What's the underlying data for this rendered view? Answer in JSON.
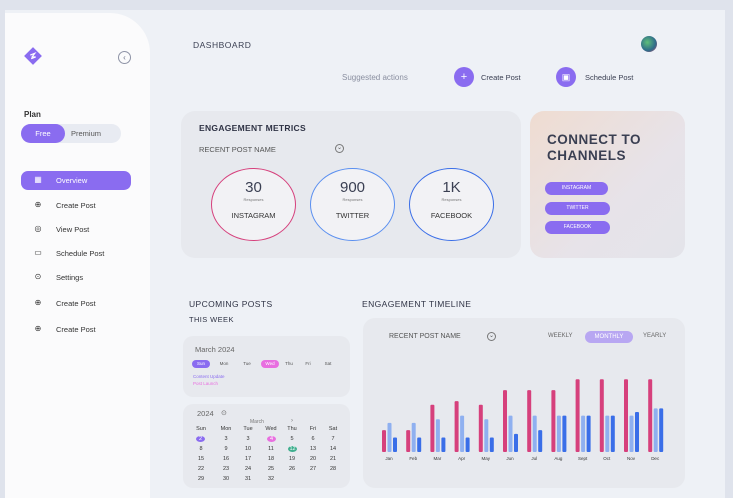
{
  "sidebar": {
    "plan_label": "Plan",
    "plan_free": "Free",
    "plan_premium": "Premium",
    "items": [
      {
        "label": "Overview",
        "icon": "grid-icon",
        "active": true
      },
      {
        "label": "Create Post",
        "icon": "plus-circle-icon"
      },
      {
        "label": "View Post",
        "icon": "eye-icon"
      },
      {
        "label": "Schedule Post",
        "icon": "calendar-icon"
      },
      {
        "label": "Settings",
        "icon": "gear-icon"
      },
      {
        "label": "Create Post",
        "icon": "plus-circle-icon"
      },
      {
        "label": "Create Post",
        "icon": "plus-circle-icon"
      }
    ]
  },
  "header": {
    "title": "DASHBOARD",
    "suggested": "Suggested actions",
    "create_post": "Create Post",
    "schedule_post": "Schedule Post"
  },
  "metrics": {
    "title": "ENGAGEMENT METRICS",
    "subtitle": "RECENT POST NAME",
    "items": [
      {
        "value": "30",
        "resp": "Responses",
        "name": "INSTAGRAM",
        "color": "#d6407c"
      },
      {
        "value": "900",
        "resp": "Responses",
        "name": "TWITTER",
        "color": "#5a8ff0"
      },
      {
        "value": "1K",
        "resp": "Responses",
        "name": "FACEBOOK",
        "color": "#3a6ee8"
      }
    ]
  },
  "connect": {
    "title": "CONNECT TO CHANNELS",
    "buttons": [
      "INSTAGRAM",
      "TWITTER",
      "FACEBOOK"
    ]
  },
  "upcoming": {
    "title": "UPCOMING POSTS",
    "this_week": "THIS WEEK",
    "month": "March 2024",
    "days": [
      "Sun",
      "Mon",
      "Tue",
      "Wed",
      "Thu",
      "Fri",
      "Sat"
    ],
    "event1": "Content Update",
    "event2": "Post Launch",
    "year": "2024",
    "month_small": "March",
    "calendar": [
      [
        "Sun",
        "Mon",
        "Tue",
        "Wed",
        "Thu",
        "Fri",
        "Sat"
      ],
      [
        "2",
        "3",
        "3",
        "4",
        "5",
        "6",
        "7"
      ],
      [
        "8",
        "9",
        "10",
        "11",
        "12",
        "13",
        "14"
      ],
      [
        "15",
        "16",
        "17",
        "18",
        "19",
        "20",
        "21"
      ],
      [
        "22",
        "23",
        "24",
        "25",
        "26",
        "27",
        "28"
      ],
      [
        "29",
        "30",
        "31",
        "32",
        "",
        "",
        ""
      ]
    ]
  },
  "timeline": {
    "title": "ENGAGEMENT TIMELINE",
    "subtitle": "RECENT POST NAME",
    "weekly": "WEEKLY",
    "monthly": "MONTHLY",
    "yearly": "YEARLY"
  },
  "chart_data": {
    "type": "bar",
    "categories": [
      "Jan",
      "Feb",
      "Mar",
      "Apr",
      "May",
      "Jun",
      "Jul",
      "Aug",
      "Sept",
      "Oct",
      "Nov",
      "Dec"
    ],
    "series": [
      {
        "values": [
          6,
          6,
          13,
          14,
          13,
          17,
          17,
          17,
          20,
          20,
          20,
          20
        ],
        "color": "#d6407c"
      },
      {
        "values": [
          8,
          8,
          9,
          10,
          9,
          10,
          10,
          10,
          10,
          10,
          10,
          12
        ],
        "color": "#8fb0f0"
      },
      {
        "values": [
          4,
          4,
          4,
          4,
          4,
          5,
          6,
          10,
          10,
          10,
          11,
          12
        ],
        "color": "#3a6ee8"
      }
    ],
    "ylim": [
      0,
      22
    ]
  }
}
